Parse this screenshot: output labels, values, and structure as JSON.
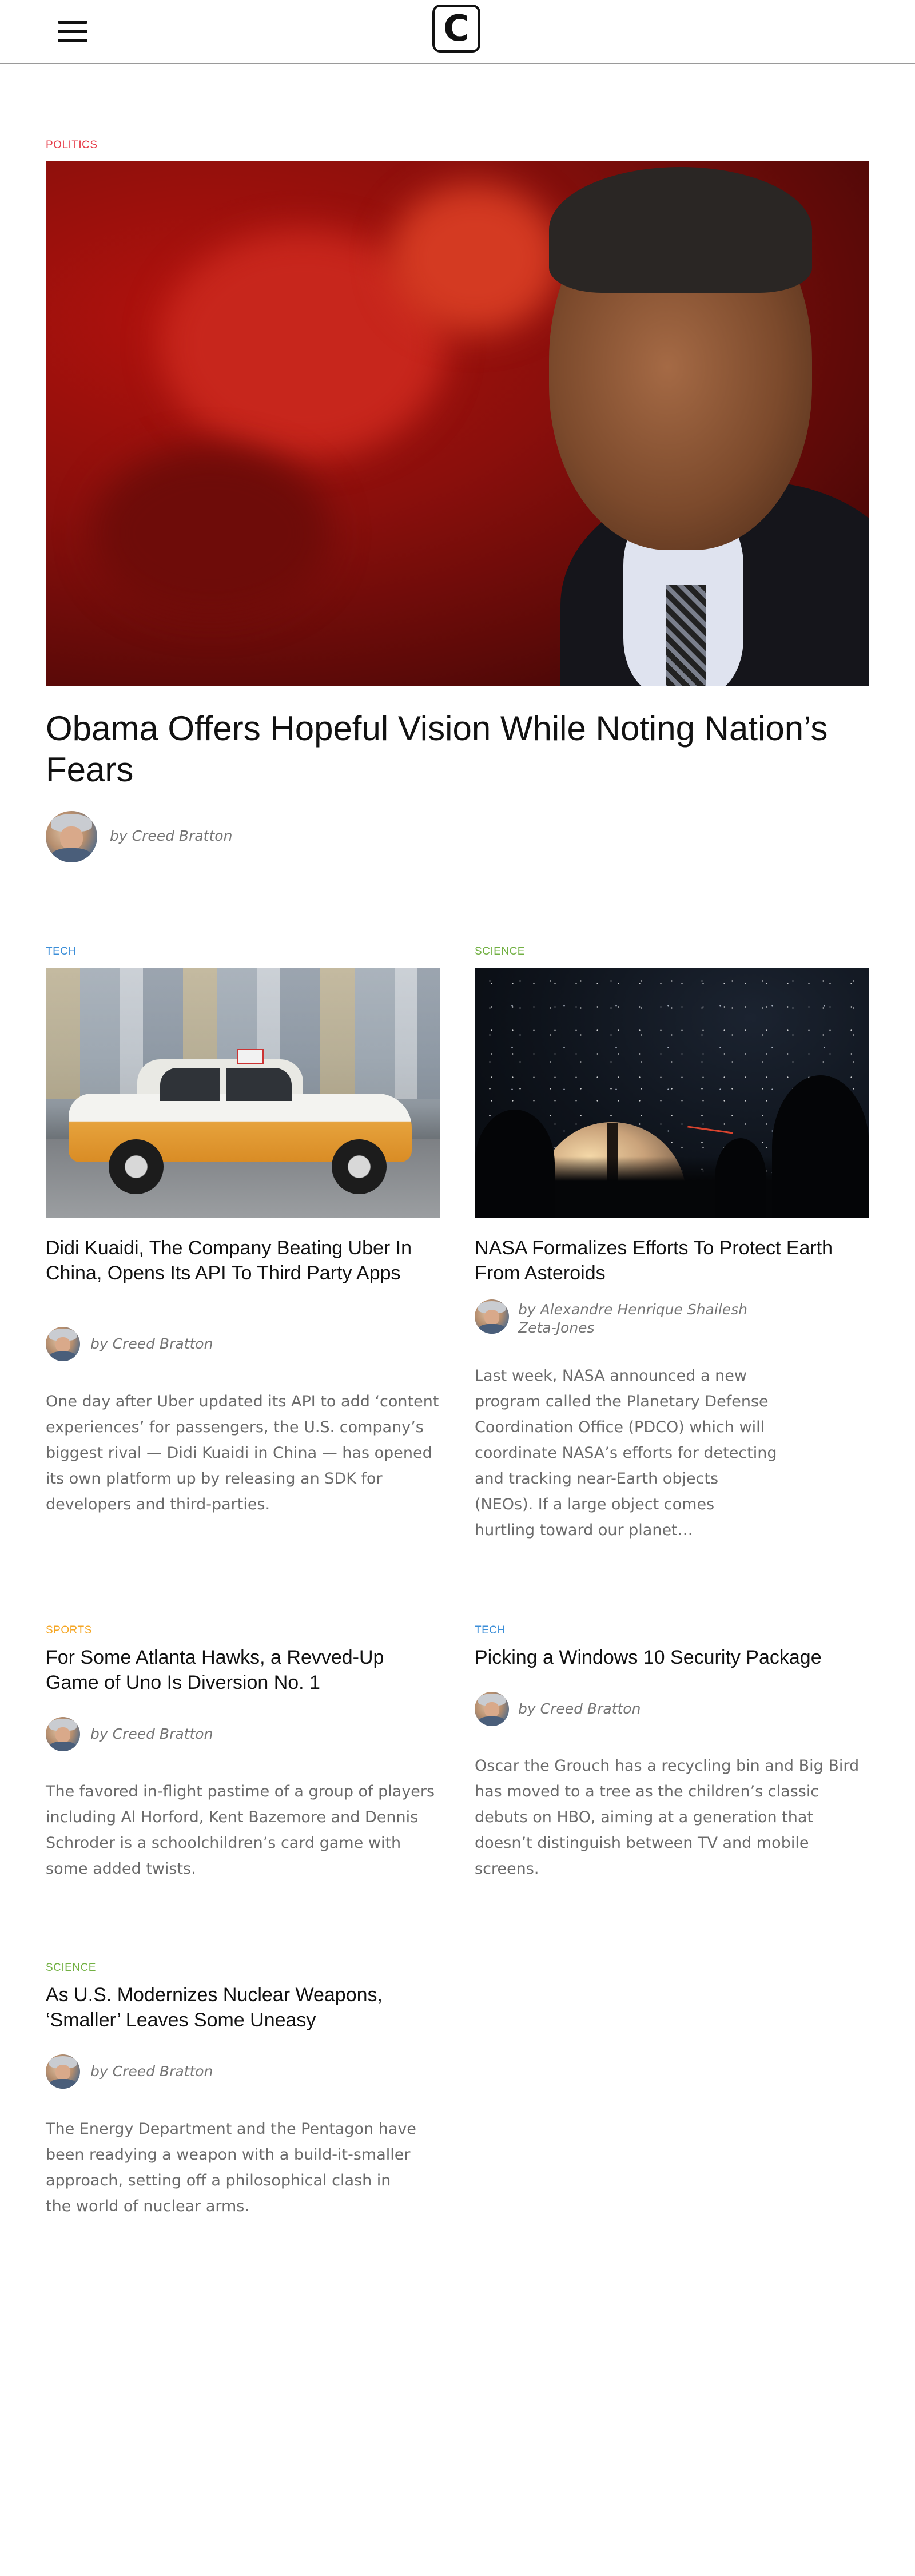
{
  "header": {
    "menu_icon": "hamburger-menu-icon",
    "logo_letter": "C"
  },
  "featured": {
    "category": "POLITICS",
    "image": "obama-portrait-red-background",
    "title": "Obama Offers Hopeful Vision While Noting Nation’s Fears",
    "byline": "by Creed Bratton"
  },
  "articles": [
    {
      "category": "TECH",
      "image": "taxi-car-motion-blur",
      "title": "Didi Kuaidi, The Company Beating Uber In China, Opens Its API To Third Party Apps",
      "byline": "by Creed Bratton",
      "excerpt": "One day after Uber updated its API to add ‘content experiences’ for passengers, the U.S. company’s biggest rival — Didi Kuaidi in China — has opened its own platform up by releasing an SDK for developers and third-parties."
    },
    {
      "category": "SCIENCE",
      "image": "observatory-night-sky",
      "title": "NASA Formalizes Efforts To Protect Earth From Asteroids",
      "byline": "by Alexandre Henrique Shailesh Zeta-Jones",
      "excerpt": "Last week, NASA announced a new program called the Planetary Defense Coordination Office (PDCO) which will coordinate NASA’s efforts for detecting and tracking near-Earth objects (NEOs). If a large object comes hurtling toward our planet…"
    },
    {
      "category": "SPORTS",
      "title": "For Some Atlanta Hawks, a Revved-Up Game of Uno Is Diversion No. 1",
      "byline": "by Creed Bratton",
      "excerpt": "The favored in-flight pastime of a group of players including Al Horford, Kent Bazemore and Dennis Schroder is a schoolchildren’s card game with some added twists."
    },
    {
      "category": "TECH",
      "title": "Picking a Windows 10 Security Package",
      "byline": "by Creed Bratton",
      "excerpt": "Oscar the Grouch has a recycling bin and Big Bird has moved to a tree as the children’s classic debuts on HBO, aiming at a generation that doesn’t distinguish between TV and mobile screens."
    },
    {
      "category": "SCIENCE",
      "title": "As U.S. Modernizes Nuclear Weapons, ‘Smaller’ Leaves Some Uneasy",
      "byline": "by Creed Bratton",
      "excerpt": "The Energy Department and the Pentagon have been readying a weapon with a build-it-smaller approach, setting off a philosophical clash in the world of nuclear arms."
    }
  ],
  "colors": {
    "politics": "#e63946",
    "tech": "#3b8ed8",
    "science": "#72b043",
    "sports": "#f5a623"
  }
}
